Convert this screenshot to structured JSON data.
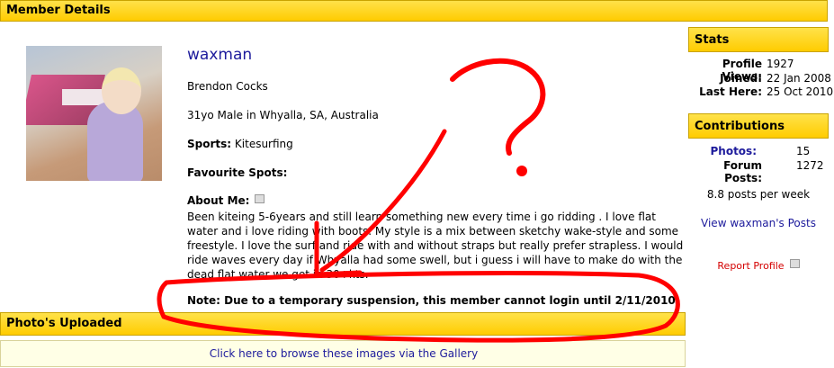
{
  "sections": {
    "member_details": "Member Details",
    "photos_uploaded": "Photo's Uploaded",
    "stats": "Stats",
    "contributions": "Contributions"
  },
  "profile": {
    "username": "waxman",
    "real_name": "Brendon Cocks",
    "location": "31yo Male in Whyalla, SA, Australia",
    "sports_label": "Sports:",
    "sports_value": "Kitesurfing",
    "favourite_spots_label": "Favourite Spots:",
    "about_label": "About Me:",
    "about_text": "Been kiteing 5-6years and still learn something new every time i go ridding . I love flat water and i love riding with boots. My style is a mix between sketchy wake-style and some freestyle. I love the surf and ride with and without straps but really prefer strapless. I would ride waves every day if Whyalla had some swell, but i guess i will have to make do with the dead flat water we get in 30+kts.",
    "note": "Note: Due to a temporary suspension, this member cannot login until 2/11/2010"
  },
  "gallery": {
    "link": "Click here to browse these images via the Gallery"
  },
  "stats": {
    "profile_views_label": "Profile Views:",
    "profile_views": "1927",
    "joined_label": "Joined:",
    "joined": "22 Jan 2008",
    "last_here_label": "Last Here:",
    "last_here": "25 Oct 2010"
  },
  "contributions": {
    "photos_label": "Photos:",
    "photos": "15",
    "forum_posts_label": "Forum Posts:",
    "forum_posts": "1272",
    "per_week": "8.8 posts per week",
    "view_posts": "View waxman's Posts",
    "report": "Report Profile"
  },
  "colors": {
    "header_bar": "#ffcc00",
    "link": "#1d1b9c",
    "annotation": "#ff0000",
    "report_link": "#d40000"
  },
  "icons": {
    "flag": "flag-icon",
    "report_flag": "flag-icon"
  }
}
